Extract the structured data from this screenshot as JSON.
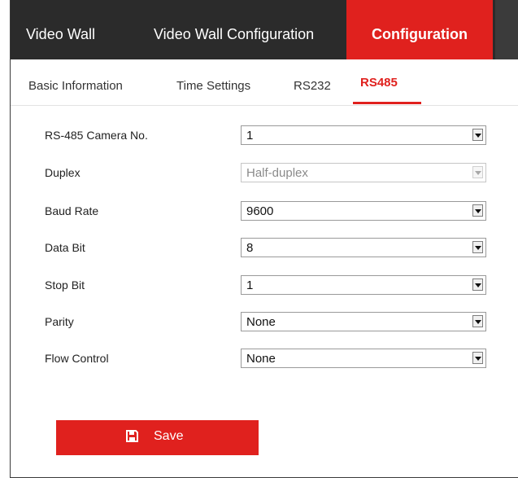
{
  "topnav": {
    "items": [
      {
        "label": "Video Wall"
      },
      {
        "label": "Video Wall Configuration"
      },
      {
        "label": "Configuration"
      }
    ]
  },
  "tabs": [
    {
      "label": "Basic Information"
    },
    {
      "label": "Time Settings"
    },
    {
      "label": "RS232"
    },
    {
      "label": "RS485"
    }
  ],
  "form": {
    "fields": [
      {
        "label": "RS-485 Camera No.",
        "value": "1"
      },
      {
        "label": "Duplex",
        "value": "Half-duplex"
      },
      {
        "label": "Baud Rate",
        "value": "9600"
      },
      {
        "label": "Data Bit",
        "value": "8"
      },
      {
        "label": "Stop Bit",
        "value": "1"
      },
      {
        "label": "Parity",
        "value": "None"
      },
      {
        "label": "Flow Control",
        "value": "None"
      }
    ]
  },
  "save_button": {
    "label": "Save"
  },
  "icons": {
    "save": "floppy-disk-icon",
    "dropdown": "chevron-down-icon"
  },
  "colors": {
    "accent": "#e0211e",
    "nav_bg": "#2b2b2b"
  }
}
